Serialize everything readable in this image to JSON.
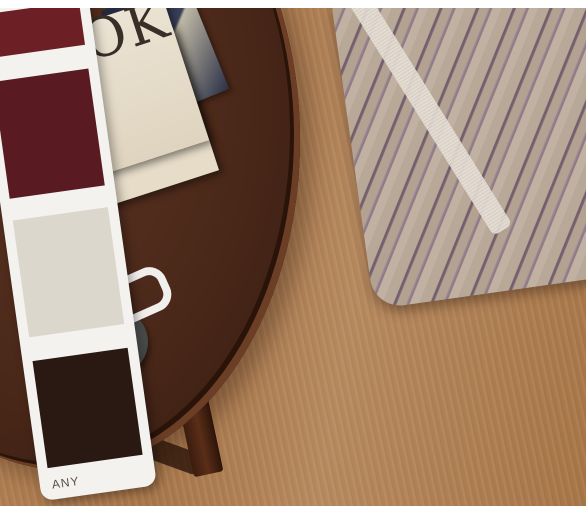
{
  "scene": {
    "description_free": true,
    "swatch_card": {
      "swatches": [
        {
          "name": "swatch-crimson",
          "color": "#6d1f26"
        },
        {
          "name": "swatch-burgundy",
          "color": "#5a1a22"
        },
        {
          "name": "swatch-cream",
          "color": "#dcd7cc"
        },
        {
          "name": "swatch-espresso",
          "color": "#2a1912"
        }
      ],
      "label": "ANY"
    },
    "book": {
      "cover_text": "OOK"
    },
    "colors": {
      "floor": "#ad7b4e",
      "table": "#4a2819",
      "pillow": "#b3a292",
      "coffee": "#a4652a"
    }
  }
}
